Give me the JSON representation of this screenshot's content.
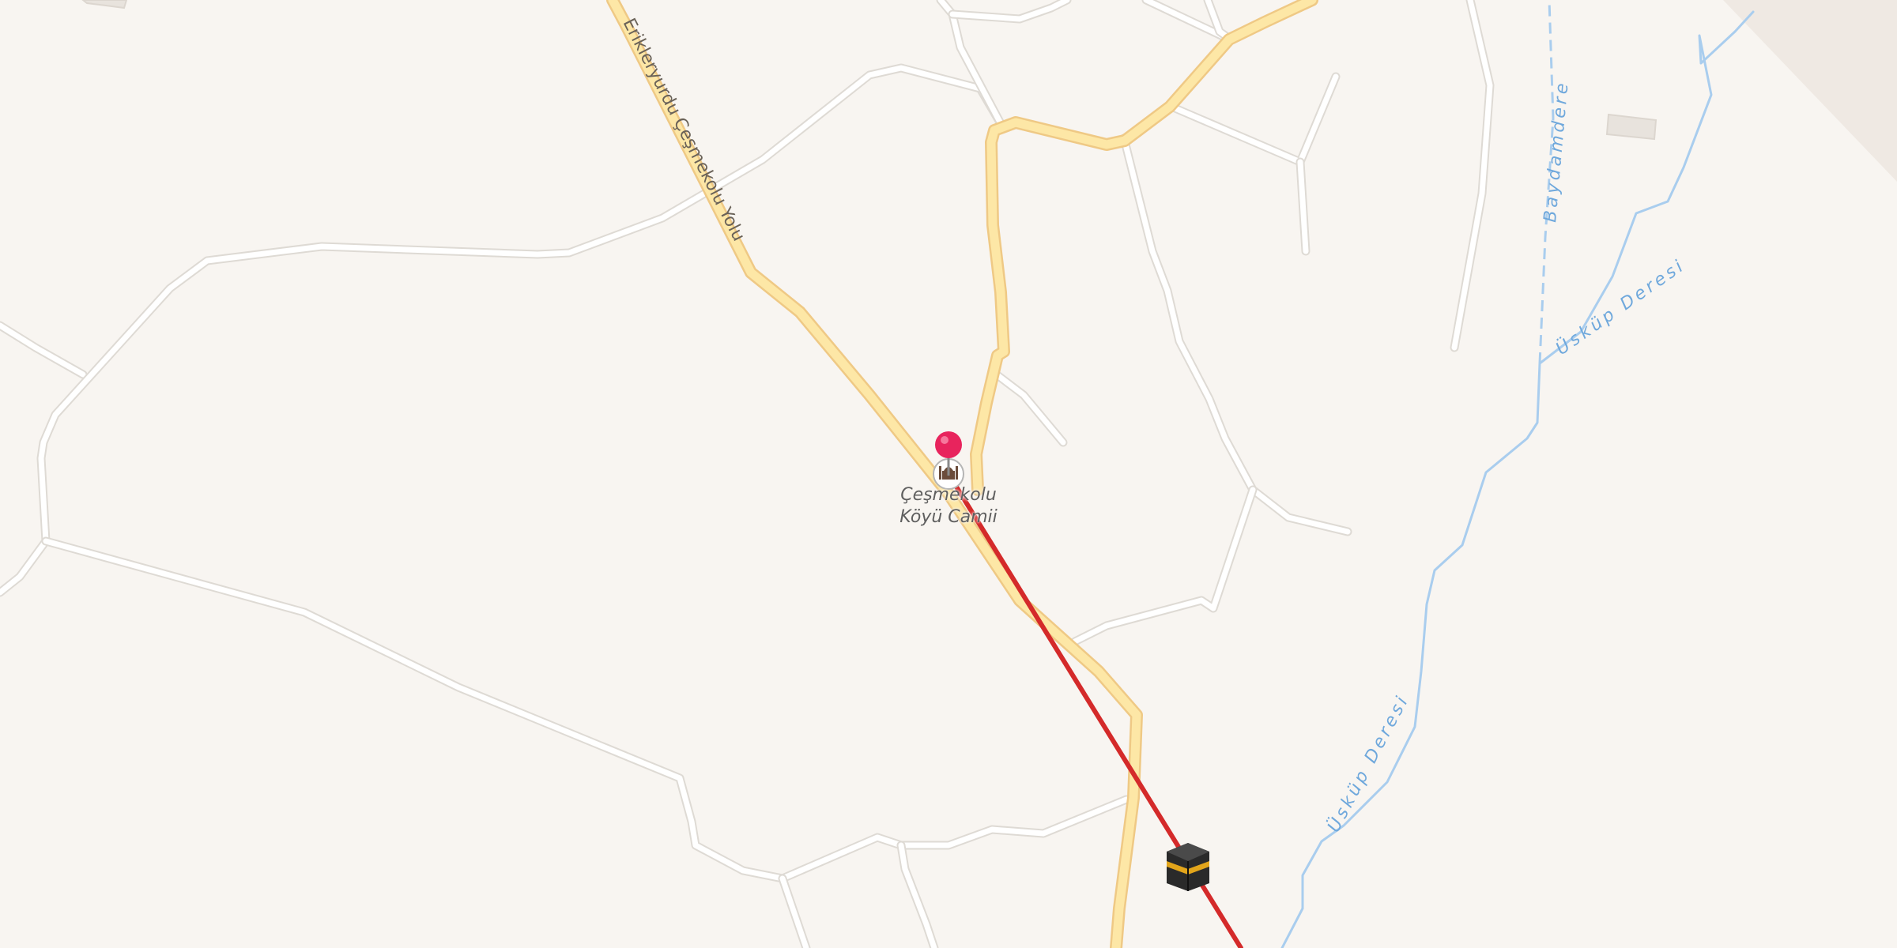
{
  "map": {
    "colors": {
      "land": "#f8f5f1",
      "minor_road": "#ffffff",
      "main_road": "#fde7a6",
      "stream": "#a9cdee",
      "route_line": "#d42a2a",
      "pin": "#e8245d"
    },
    "road_labels": {
      "main_road": "Erikleryurdu Çeşmekolu Yolu"
    },
    "water_labels": {
      "stream_1": "Üsküp Deresi",
      "stream_2": "Üsküp Deresi",
      "stream_3": "Baydamdere"
    },
    "poi": {
      "name_line1": "Çeşmekolu",
      "name_line2": "Köyü Camii",
      "icon": "mosque-icon"
    },
    "destination_icon": "kaaba-icon",
    "pin_icon": "location-pin-icon"
  }
}
